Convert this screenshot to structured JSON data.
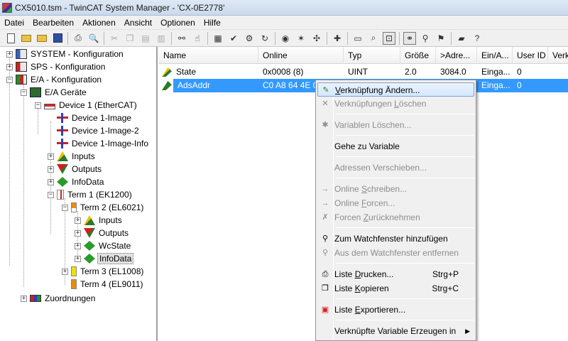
{
  "window": {
    "title": "CX5010.tsm - TwinCAT System Manager - 'CX-0E2778'"
  },
  "menubar": {
    "items": [
      "Datei",
      "Bearbeiten",
      "Aktionen",
      "Ansicht",
      "Optionen",
      "Hilfe"
    ]
  },
  "toolbar": {
    "icons": [
      "new-file-icon",
      "open-folder-icon",
      "open-target-icon",
      "save-icon",
      "print-icon",
      "print-preview-icon",
      "cut-icon",
      "copy-icon",
      "paste-icon",
      "paste-special-icon",
      "find-icon",
      "find-next-icon",
      "check-config-icon",
      "activate-config-icon",
      "build-icon",
      "restart-icon",
      "set-run-mode-icon",
      "scan-devices-icon",
      "toggle-free-run-icon",
      "add-item-icon",
      "delete-item-icon",
      "search-icon",
      "show-online-icon",
      "zoom-icon",
      "watch-icon",
      "help-icon"
    ]
  },
  "tree": {
    "items": [
      {
        "label": "SYSTEM - Konfiguration",
        "icon": "system-icon"
      },
      {
        "label": "SPS - Konfiguration",
        "icon": "plc-icon"
      },
      {
        "label": "E/A - Konfiguration",
        "icon": "io-config-icon"
      },
      {
        "label": "E/A Geräte",
        "icon": "io-devices-icon"
      },
      {
        "label": "Device 1 (EtherCAT)",
        "icon": "ethercat-device-icon"
      },
      {
        "label": "Device 1-Image",
        "icon": "image-icon"
      },
      {
        "label": "Device 1-Image-2",
        "icon": "image-icon"
      },
      {
        "label": "Device 1-Image-Info",
        "icon": "image-icon"
      },
      {
        "label": "Inputs",
        "icon": "inputs-icon"
      },
      {
        "label": "Outputs",
        "icon": "outputs-icon"
      },
      {
        "label": "InfoData",
        "icon": "infodata-icon"
      },
      {
        "label": "Term 1 (EK1200)",
        "icon": "coupler-icon"
      },
      {
        "label": "Term 2 (EL6021)",
        "icon": "terminal-icon"
      },
      {
        "label": "Inputs",
        "icon": "inputs-icon"
      },
      {
        "label": "Outputs",
        "icon": "outputs-icon"
      },
      {
        "label": "WcState",
        "icon": "wcstate-icon"
      },
      {
        "label": "InfoData",
        "icon": "infodata-icon"
      },
      {
        "label": "Term 3 (EL1008)",
        "icon": "terminal-icon"
      },
      {
        "label": "Term 4 (EL9011)",
        "icon": "terminal-icon"
      },
      {
        "label": "Zuordnungen",
        "icon": "mappings-icon"
      }
    ]
  },
  "listview": {
    "columns": [
      "Name",
      "Online",
      "Typ",
      "Größe",
      ">Adre...",
      "Ein/A...",
      "User ID",
      "Verk"
    ],
    "rows": [
      {
        "name": "State",
        "online": "0x0008 (8)",
        "typ": "UINT",
        "groesse": "2.0",
        "adresse": "3084.0",
        "einaus": "Einga...",
        "userid": "0"
      },
      {
        "name": "AdsAddr",
        "online": "C0 A8 64 4E 02",
        "typ": "",
        "groesse": "",
        "adresse": "",
        "einaus": "Einga...",
        "userid": "0"
      }
    ]
  },
  "context_menu": {
    "items": [
      {
        "pre": "",
        "u": "V",
        "post": "erknüpfung Ändern...",
        "shortcut": ""
      },
      {
        "pre": "Verknüpfungen ",
        "u": "L",
        "post": "öschen",
        "shortcut": ""
      },
      {
        "pre": "Variablen Löschen...",
        "u": "",
        "post": "",
        "shortcut": ""
      },
      {
        "pre": "Gehe zu Variable",
        "u": "",
        "post": "",
        "shortcut": ""
      },
      {
        "pre": "Adressen Verschieben...",
        "u": "",
        "post": "",
        "shortcut": ""
      },
      {
        "pre": "Online ",
        "u": "S",
        "post": "chreiben...",
        "shortcut": ""
      },
      {
        "pre": "Online ",
        "u": "F",
        "post": "orcen...",
        "shortcut": ""
      },
      {
        "pre": "Forcen ",
        "u": "Z",
        "post": "urücknehmen",
        "shortcut": ""
      },
      {
        "pre": "Zum Watchfenster hinzufügen",
        "u": "",
        "post": "",
        "shortcut": ""
      },
      {
        "pre": "Aus dem Watchfenster entfernen",
        "u": "",
        "post": "",
        "shortcut": ""
      },
      {
        "pre": "Liste ",
        "u": "D",
        "post": "rucken...",
        "shortcut": "Strg+P"
      },
      {
        "pre": "Liste ",
        "u": "K",
        "post": "opieren",
        "shortcut": "Strg+C"
      },
      {
        "pre": "Liste ",
        "u": "E",
        "post": "xportieren...",
        "shortcut": ""
      },
      {
        "pre": "Verknüpfte Variable Erzeugen in",
        "u": "",
        "post": "",
        "shortcut": ""
      }
    ]
  }
}
